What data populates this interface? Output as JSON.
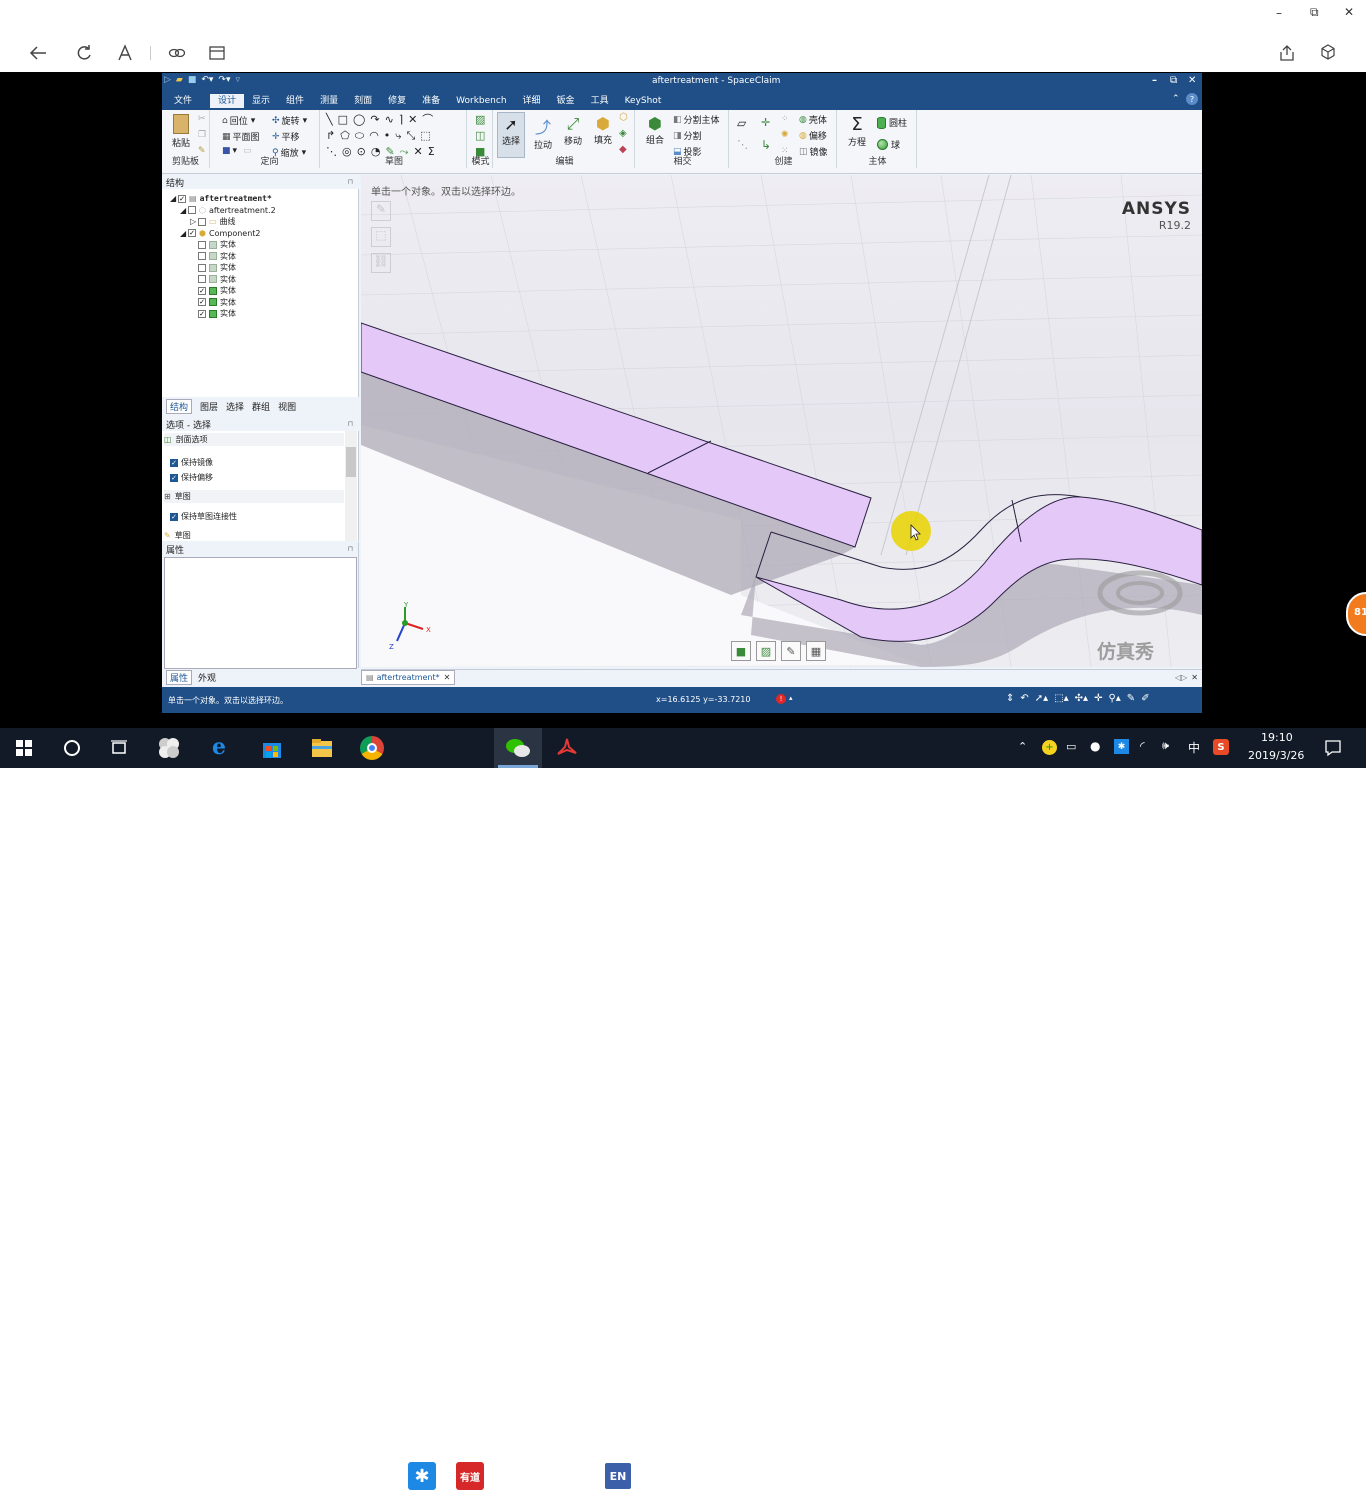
{
  "browser": {
    "window_controls": {
      "minimize": "–",
      "restore": "⧉",
      "close": "✕"
    }
  },
  "sc": {
    "title": "aftertreatment - SpaceClaim",
    "title_controls": {
      "minimize": "–",
      "restore": "⧉",
      "close": "✕"
    },
    "menu": {
      "file": "文件",
      "tabs": [
        "设计",
        "显示",
        "组件",
        "测量",
        "刻面",
        "修复",
        "准备",
        "Workbench",
        "详细",
        "钣金",
        "工具",
        "KeyShot"
      ]
    },
    "ribbon": {
      "clipboard": {
        "paste": "粘贴",
        "label": "剪贴板"
      },
      "orient": {
        "home": "回位",
        "plan": "平面图",
        "rotate": "旋转",
        "pan": "平移",
        "zoom": "缩放",
        "label": "定向"
      },
      "sketch": {
        "label": "草图"
      },
      "mode": {
        "label": "模式"
      },
      "edit": {
        "select": "选择",
        "pull": "拉动",
        "move": "移动",
        "fill": "填充",
        "label": "编辑"
      },
      "intersect": {
        "combine": "组合",
        "split_body": "分割主体",
        "split": "分割",
        "project": "投影",
        "label": "相交"
      },
      "create": {
        "shell": "壳体",
        "offset": "偏移",
        "mirror": "镜像",
        "label": "创建"
      },
      "body": {
        "equation": "方程",
        "cylinder": "圆柱",
        "sphere": "球",
        "label": "主体"
      }
    },
    "structure": {
      "header": "结构",
      "tree": {
        "root": "aftertreatment*",
        "child": "aftertreatment.2",
        "curves": "曲线",
        "component": "Component2",
        "bodies": [
          "实体",
          "实体",
          "实体",
          "实体",
          "实体",
          "实体",
          "实体"
        ]
      },
      "tabs": [
        "结构",
        "图层",
        "选择",
        "群组",
        "视图"
      ]
    },
    "options": {
      "header": "选项 - 选择",
      "section1": "剖面选项",
      "keep_mirror": "保持镜像",
      "keep_offset": "保持偏移",
      "section2": "草图",
      "keep_sketch": "保持草图连接性",
      "section3": "草图"
    },
    "props": {
      "header": "属性",
      "tabs": [
        "属性",
        "外观"
      ]
    },
    "viewport": {
      "hint": "单击一个对象。双击以选择环边。",
      "ansys": "ANSYS",
      "version": "R19.2",
      "watermark": "仿真秀",
      "doc_tab": "aftertreatment*",
      "axis_x": "X",
      "axis_y": "Y",
      "axis_z": "Z"
    },
    "status": {
      "message": "单击一个对象。双击以选择环边。",
      "coords": "x=16.6125  y=-33.7210"
    }
  },
  "taskbar": {
    "time": "19:10",
    "date": "2019/3/26",
    "ime": "中",
    "badge": "81",
    "apps": [
      "youdao",
      "EN"
    ],
    "youdao": "有道"
  },
  "colors": {
    "title_blue": "#1f4f86",
    "body_purple": "#e3c8f8",
    "cursor_yellow": "#e9d400"
  }
}
